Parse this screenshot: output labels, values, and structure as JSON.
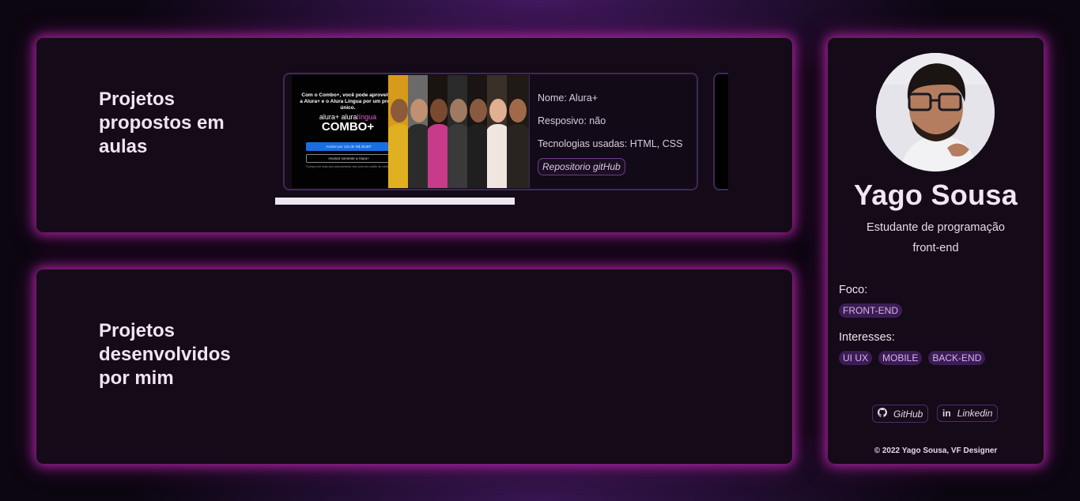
{
  "proposed_section": {
    "title": "Projetos propostos em aulas",
    "project": {
      "thumbnail": {
        "headline": "Com o Combo+, você pode aproveitar a Alura+ e o Alura Língua por um preço único.",
        "brand_a": "alura+",
        "brand_b_prefix": "alura",
        "brand_b_suffix": "língua",
        "product": "COMBO+",
        "primary_button": "Assine por 12x de R$ 29,90*",
        "secondary_button": "Assinar somente a Alura+",
        "footnote": "*Compra em reais sem parcelamento sem juros em cartão de crédito"
      },
      "name_line": "Nome: Alura+",
      "responsive_line": "Resposivo: não",
      "tech_line": "Tecnologias usadas: HTML, CSS",
      "repo_button": "Repositorio gitHub"
    }
  },
  "developed_section": {
    "title": "Projetos desenvolvidos por mim"
  },
  "profile": {
    "name": "Yago Sousa",
    "subtitle_line1": "Estudante de programação",
    "subtitle_line2": "front-end",
    "focus_label": "Foco:",
    "focus_tags": [
      "FRONT-END"
    ],
    "interests_label": "Interesses:",
    "interest_tags": [
      "UI UX",
      "MOBILE",
      "BACK-END"
    ],
    "github_label": "GitHub",
    "linkedin_label": "Linkedin",
    "copyright": "© 2022 Yago Sousa, VF Designer"
  },
  "icons": {
    "github": "github-icon",
    "linkedin": "linkedin-icon"
  },
  "colors": {
    "background": "#0b0610",
    "panel": "#150a18",
    "glow": "#c828be",
    "tag_bg": "#3c1c55",
    "tag_text": "#d2b4e8",
    "promo_button": "#1a6fe0",
    "promo_accent": "#e05dd0"
  }
}
